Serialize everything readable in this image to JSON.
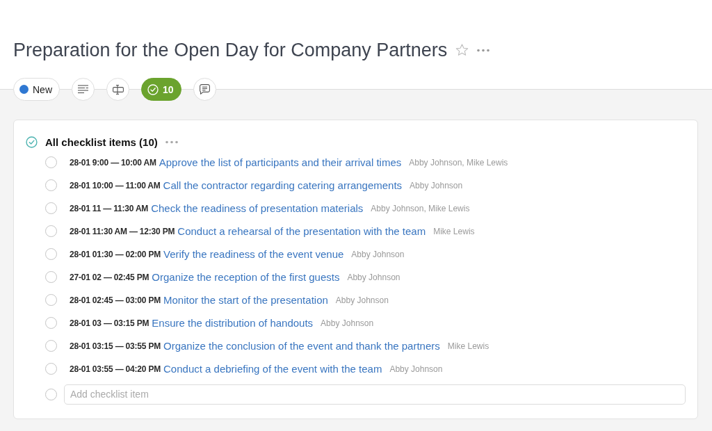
{
  "title": "Preparation for the Open Day for Company Partners",
  "starred": false,
  "tabs": [
    {
      "kind": "status",
      "label": "New",
      "color": "#2f78d2",
      "selected": false
    },
    {
      "kind": "icon",
      "selected": false
    },
    {
      "kind": "icon",
      "selected": false
    },
    {
      "kind": "count",
      "count": "10",
      "selected": true
    },
    {
      "kind": "icon",
      "selected": false
    }
  ],
  "checklist": {
    "title": "All checklist items (10)",
    "items": [
      {
        "checked": false,
        "time": "28-01 9:00 — 10:00 AM",
        "title": "Approve the list of participants and their arrival times",
        "assignees": "Abby Johnson, Mike Lewis"
      },
      {
        "checked": false,
        "time": "28-01 10:00 — 11:00 AM",
        "title": "Call the contractor regarding catering arrangements",
        "assignees": "Abby Johnson"
      },
      {
        "checked": false,
        "time": "28-01 11 — 11:30 AM",
        "title": "Check the readiness of presentation materials",
        "assignees": "Abby Johnson, Mike Lewis"
      },
      {
        "checked": false,
        "time": "28-01 11:30 AM — 12:30 PM",
        "title": "Conduct a rehearsal of the presentation with the team",
        "assignees": "Mike Lewis"
      },
      {
        "checked": false,
        "time": "28-01 01:30 — 02:00 PM",
        "title": "Verify the readiness of the event venue",
        "assignees": "Abby Johnson"
      },
      {
        "checked": false,
        "time": "27-01 02 — 02:45 PM",
        "title": "Organize the reception of the first guests",
        "assignees": "Abby Johnson"
      },
      {
        "checked": false,
        "time": "28-01 02:45 — 03:00 PM",
        "title": "Monitor the start of the presentation",
        "assignees": "Abby Johnson"
      },
      {
        "checked": false,
        "time": "28-01 03 — 03:15 PM",
        "title": "Ensure the distribution of handouts",
        "assignees": "Abby Johnson"
      },
      {
        "checked": false,
        "time": "28-01 03:15 — 03:55 PM",
        "title": "Organize the conclusion of the event and thank the partners",
        "assignees": "Mike Lewis"
      },
      {
        "checked": false,
        "time": "28-01 03:55 — 04:20 PM",
        "title": "Conduct a debriefing of the event with the team",
        "assignees": "Abby Johnson"
      }
    ],
    "new_item": {
      "checked": false,
      "placeholder": "Add checklist item"
    }
  }
}
